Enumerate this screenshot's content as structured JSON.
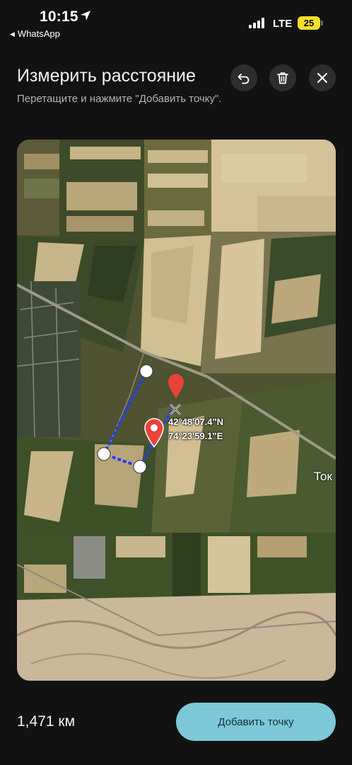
{
  "status_bar": {
    "time": "10:15",
    "back_app": "WhatsApp",
    "network": "LTE",
    "battery": "25",
    "location_icon": "location-arrow-icon",
    "signal_icon": "signal-bars-icon",
    "accent": "#f2e12a"
  },
  "header": {
    "title": "Измерить расстояние",
    "subtitle": "Перетащите и нажмите \"Добавить точку\".",
    "actions": [
      {
        "name": "undo",
        "icon": "undo-icon"
      },
      {
        "name": "delete",
        "icon": "trash-icon"
      },
      {
        "name": "close",
        "icon": "close-icon"
      }
    ]
  },
  "map": {
    "type": "satellite",
    "coordinates": {
      "lat": "42°48'07.4\"N",
      "lon": "74°23'59.1\"E"
    },
    "place_label": "Ток",
    "measure_line_color": "#1f3dff",
    "pin_color": "#e8443a",
    "pin_icon": "map-pin-icon",
    "crosshair_icon": "crosshair-icon"
  },
  "footer": {
    "distance": "1,471 км",
    "add_point_label": "Добавить точку",
    "button_color": "#7cc8d6"
  }
}
